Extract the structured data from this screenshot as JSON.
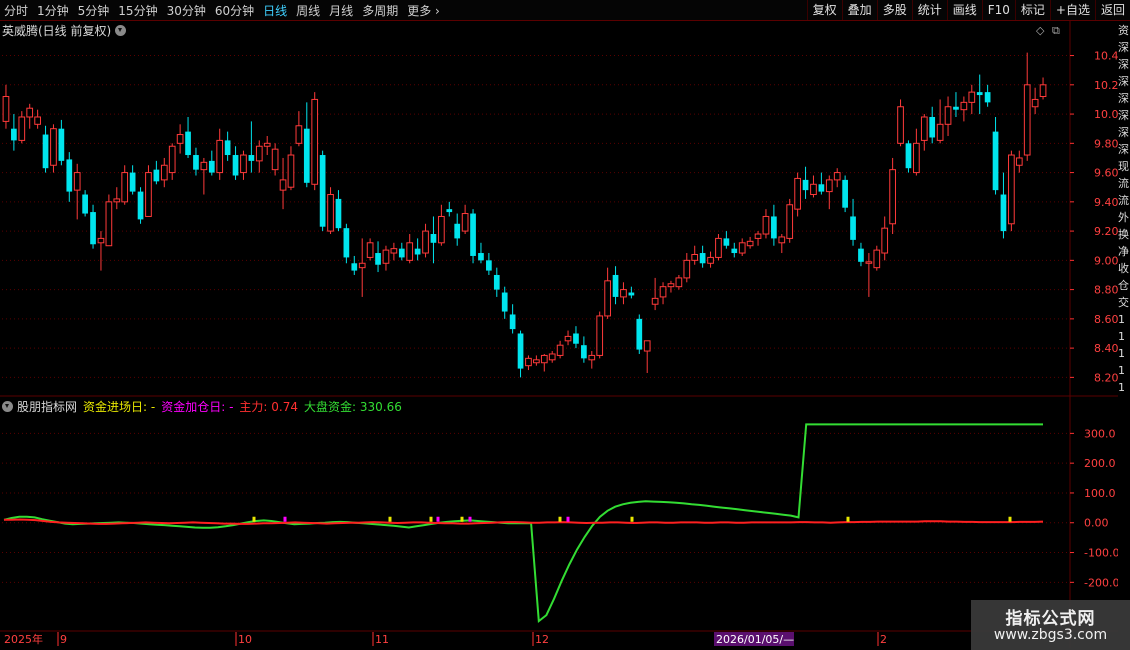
{
  "toolbar": {
    "periods": [
      "分时",
      "1分钟",
      "5分钟",
      "15分钟",
      "30分钟",
      "60分钟",
      "日线",
      "周线",
      "月线",
      "多周期",
      "更多"
    ],
    "active_period": "日线",
    "actions": [
      "复权",
      "叠加",
      "多股",
      "统计",
      "画线",
      "F10",
      "标记",
      "+自选",
      "返回"
    ]
  },
  "main_chart": {
    "title": "英威腾(日线 前复权)",
    "price_axis": [
      "10.40",
      "10.20",
      "10.00",
      "9.80",
      "9.60",
      "9.40",
      "9.20",
      "9.00",
      "8.80",
      "8.60",
      "8.40",
      "8.20"
    ],
    "y_range": [
      8.1,
      10.52
    ]
  },
  "indicator": {
    "name": "股朋指标网",
    "labels": [
      {
        "text": "资金进场日: -",
        "color": "#e8e800"
      },
      {
        "text": "资金加仓日: -",
        "color": "#ff00ff"
      },
      {
        "text": "主力: 0.74",
        "color": "#ff3030"
      },
      {
        "text": "大盘资金: 330.66",
        "color": "#33dd33"
      }
    ],
    "axis": [
      "300.0",
      "200.0",
      "100.0",
      "0.00",
      "-100.0",
      "-200.0"
    ],
    "y_range": [
      -360,
      365
    ]
  },
  "time_axis": {
    "labels": [
      "2025年",
      "9",
      "10",
      "11",
      "12",
      "1",
      "2"
    ],
    "highlight": "2026/01/05/—"
  },
  "right_strip": [
    "资",
    "深",
    "深",
    "深",
    "深",
    "深",
    "深",
    "深",
    "现",
    "流",
    "流",
    "外",
    "换",
    "净",
    "收",
    "仓",
    "交",
    "1",
    "1",
    "1",
    "1",
    "1"
  ],
  "watermark": {
    "title": "指标公式网",
    "url": "www.zbgs3.com"
  },
  "colors": {
    "up": "#ff3a3a",
    "down": "#00e5ee",
    "grid": "#5a0000",
    "main_line": "#33dd33",
    "sub_line": "#ff2020"
  },
  "chart_data": {
    "type": "candlestick",
    "candles": [
      [
        9.95,
        10.2,
        9.9,
        10.12
      ],
      [
        9.9,
        10.0,
        9.75,
        9.82
      ],
      [
        9.82,
        10.02,
        9.8,
        9.98
      ],
      [
        9.98,
        10.07,
        9.9,
        10.04
      ],
      [
        9.93,
        10.03,
        9.9,
        9.98
      ],
      [
        9.86,
        9.92,
        9.6,
        9.63
      ],
      [
        9.65,
        9.93,
        9.6,
        9.9
      ],
      [
        9.9,
        9.96,
        9.65,
        9.68
      ],
      [
        9.69,
        9.74,
        9.4,
        9.47
      ],
      [
        9.48,
        9.66,
        9.28,
        9.6
      ],
      [
        9.45,
        9.48,
        9.3,
        9.32
      ],
      [
        9.33,
        9.38,
        9.08,
        9.11
      ],
      [
        9.12,
        9.2,
        8.93,
        9.15
      ],
      [
        9.1,
        9.45,
        9.1,
        9.4
      ],
      [
        9.4,
        9.5,
        9.35,
        9.42
      ],
      [
        9.4,
        9.65,
        9.38,
        9.6
      ],
      [
        9.6,
        9.65,
        9.45,
        9.47
      ],
      [
        9.47,
        9.5,
        9.25,
        9.28
      ],
      [
        9.3,
        9.65,
        9.3,
        9.6
      ],
      [
        9.62,
        9.68,
        9.52,
        9.54
      ],
      [
        9.55,
        9.7,
        9.5,
        9.65
      ],
      [
        9.6,
        9.8,
        9.55,
        9.78
      ],
      [
        9.8,
        9.93,
        9.73,
        9.86
      ],
      [
        9.88,
        9.98,
        9.7,
        9.72
      ],
      [
        9.72,
        9.77,
        9.58,
        9.62
      ],
      [
        9.62,
        9.7,
        9.45,
        9.67
      ],
      [
        9.68,
        9.75,
        9.58,
        9.6
      ],
      [
        9.6,
        9.9,
        9.55,
        9.82
      ],
      [
        9.82,
        9.88,
        9.68,
        9.72
      ],
      [
        9.72,
        9.78,
        9.55,
        9.58
      ],
      [
        9.6,
        9.75,
        9.55,
        9.72
      ],
      [
        9.72,
        9.95,
        9.6,
        9.68
      ],
      [
        9.68,
        9.82,
        9.6,
        9.78
      ],
      [
        9.78,
        9.85,
        9.72,
        9.8
      ],
      [
        9.62,
        9.8,
        9.58,
        9.76
      ],
      [
        9.48,
        9.7,
        9.35,
        9.55
      ],
      [
        9.5,
        9.78,
        9.48,
        9.72
      ],
      [
        9.8,
        10.02,
        9.78,
        9.92
      ],
      [
        9.9,
        10.08,
        9.5,
        9.53
      ],
      [
        9.52,
        10.15,
        9.48,
        10.1
      ],
      [
        9.72,
        9.75,
        9.2,
        9.23
      ],
      [
        9.2,
        9.5,
        9.18,
        9.45
      ],
      [
        9.42,
        9.48,
        9.2,
        9.22
      ],
      [
        9.22,
        9.25,
        8.98,
        9.02
      ],
      [
        8.98,
        9.03,
        8.9,
        8.93
      ],
      [
        8.95,
        9.15,
        8.75,
        8.98
      ],
      [
        9.02,
        9.15,
        9.0,
        9.12
      ],
      [
        9.05,
        9.13,
        8.92,
        8.97
      ],
      [
        8.98,
        9.1,
        8.93,
        9.07
      ],
      [
        9.05,
        9.12,
        9.0,
        9.08
      ],
      [
        9.08,
        9.12,
        9.0,
        9.02
      ],
      [
        9.0,
        9.18,
        8.98,
        9.12
      ],
      [
        9.08,
        9.15,
        9.0,
        9.04
      ],
      [
        9.05,
        9.25,
        9.02,
        9.2
      ],
      [
        9.18,
        9.3,
        8.98,
        9.12
      ],
      [
        9.12,
        9.38,
        9.1,
        9.3
      ],
      [
        9.35,
        9.4,
        9.3,
        9.33
      ],
      [
        9.25,
        9.32,
        9.1,
        9.15
      ],
      [
        9.2,
        9.38,
        9.18,
        9.32
      ],
      [
        9.32,
        9.35,
        8.98,
        9.03
      ],
      [
        9.05,
        9.12,
        8.98,
        9.0
      ],
      [
        9.0,
        9.05,
        8.9,
        8.93
      ],
      [
        8.9,
        8.95,
        8.75,
        8.8
      ],
      [
        8.78,
        8.82,
        8.6,
        8.65
      ],
      [
        8.63,
        8.7,
        8.5,
        8.53
      ],
      [
        8.5,
        8.52,
        8.2,
        8.26
      ],
      [
        8.28,
        8.35,
        8.25,
        8.33
      ],
      [
        8.3,
        8.35,
        8.28,
        8.32
      ],
      [
        8.3,
        8.36,
        8.24,
        8.35
      ],
      [
        8.32,
        8.38,
        8.3,
        8.36
      ],
      [
        8.35,
        8.45,
        8.33,
        8.42
      ],
      [
        8.45,
        8.52,
        8.42,
        8.48
      ],
      [
        8.5,
        8.55,
        8.4,
        8.43
      ],
      [
        8.42,
        8.48,
        8.3,
        8.33
      ],
      [
        8.32,
        8.38,
        8.26,
        8.35
      ],
      [
        8.35,
        8.65,
        8.33,
        8.62
      ],
      [
        8.62,
        8.95,
        8.6,
        8.86
      ],
      [
        8.9,
        8.96,
        8.7,
        8.75
      ],
      [
        8.75,
        8.85,
        8.7,
        8.8
      ],
      [
        8.78,
        8.82,
        8.74,
        8.76
      ],
      [
        8.6,
        8.63,
        8.36,
        8.39
      ],
      [
        8.38,
        8.4,
        8.23,
        8.45
      ],
      [
        8.7,
        8.88,
        8.66,
        8.74
      ],
      [
        8.75,
        8.85,
        8.7,
        8.82
      ],
      [
        8.82,
        8.86,
        8.78,
        8.84
      ],
      [
        8.82,
        8.9,
        8.8,
        8.88
      ],
      [
        8.88,
        9.05,
        8.85,
        9.0
      ],
      [
        9.0,
        9.1,
        8.97,
        9.04
      ],
      [
        9.05,
        9.1,
        8.95,
        8.98
      ],
      [
        8.98,
        9.06,
        8.95,
        9.02
      ],
      [
        9.02,
        9.18,
        9.0,
        9.15
      ],
      [
        9.15,
        9.2,
        9.08,
        9.1
      ],
      [
        9.08,
        9.12,
        9.02,
        9.05
      ],
      [
        9.05,
        9.15,
        9.03,
        9.12
      ],
      [
        9.1,
        9.16,
        9.08,
        9.13
      ],
      [
        9.15,
        9.2,
        9.1,
        9.18
      ],
      [
        9.18,
        9.35,
        9.15,
        9.3
      ],
      [
        9.3,
        9.38,
        9.1,
        9.15
      ],
      [
        9.12,
        9.18,
        9.05,
        9.16
      ],
      [
        9.15,
        9.42,
        9.12,
        9.38
      ],
      [
        9.35,
        9.6,
        9.3,
        9.56
      ],
      [
        9.55,
        9.64,
        9.42,
        9.48
      ],
      [
        9.45,
        9.58,
        9.43,
        9.52
      ],
      [
        9.52,
        9.6,
        9.45,
        9.47
      ],
      [
        9.47,
        9.58,
        9.35,
        9.55
      ],
      [
        9.55,
        9.63,
        9.5,
        9.6
      ],
      [
        9.55,
        9.58,
        9.33,
        9.36
      ],
      [
        9.3,
        9.42,
        9.1,
        9.14
      ],
      [
        9.08,
        9.12,
        8.96,
        8.99
      ],
      [
        8.98,
        9.05,
        8.75,
        8.99
      ],
      [
        8.95,
        9.1,
        8.93,
        9.07
      ],
      [
        9.05,
        9.3,
        9.0,
        9.22
      ],
      [
        9.25,
        9.7,
        9.18,
        9.62
      ],
      [
        9.8,
        10.1,
        9.78,
        10.05
      ],
      [
        9.8,
        9.82,
        9.6,
        9.63
      ],
      [
        9.6,
        9.9,
        9.58,
        9.8
      ],
      [
        9.82,
        10.0,
        9.75,
        9.98
      ],
      [
        9.98,
        10.05,
        9.8,
        9.84
      ],
      [
        9.82,
        10.1,
        9.8,
        9.93
      ],
      [
        9.93,
        10.12,
        9.85,
        10.05
      ],
      [
        10.05,
        10.15,
        9.98,
        10.03
      ],
      [
        10.03,
        10.12,
        9.95,
        10.08
      ],
      [
        10.08,
        10.2,
        10.0,
        10.15
      ],
      [
        10.15,
        10.27,
        10.0,
        10.13
      ],
      [
        10.15,
        10.2,
        10.05,
        10.08
      ],
      [
        9.88,
        9.98,
        9.45,
        9.48
      ],
      [
        9.45,
        9.6,
        9.15,
        9.2
      ],
      [
        9.25,
        9.75,
        9.2,
        9.72
      ],
      [
        9.65,
        9.75,
        9.6,
        9.7
      ],
      [
        9.72,
        10.42,
        9.68,
        10.2
      ],
      [
        10.05,
        10.18,
        10.0,
        10.1
      ],
      [
        10.12,
        10.25,
        10.1,
        10.2
      ]
    ],
    "indicator_series": {
      "main_force": [
        10,
        10,
        11,
        10,
        9,
        6,
        3,
        1,
        0,
        -1,
        -2,
        -3,
        -4,
        -4,
        -3,
        -2,
        -1,
        0,
        1,
        0,
        -1,
        -2,
        -1,
        0,
        1,
        0,
        -1,
        -2,
        -3,
        -3,
        -4,
        -4,
        -3,
        -2,
        -2,
        -1,
        0,
        1,
        0,
        -1,
        -2,
        -3,
        -2,
        -1,
        0,
        0,
        1,
        2,
        1,
        0,
        -1,
        0,
        1,
        1,
        0,
        -1,
        -2,
        -2,
        -3,
        -3,
        -2,
        -1,
        0,
        1,
        2,
        2,
        1,
        0,
        0,
        1,
        1,
        2,
        1,
        0,
        -1,
        0,
        0,
        1,
        1,
        0,
        -1,
        0,
        1,
        1,
        0,
        0,
        1,
        1,
        1,
        0,
        0,
        1,
        1,
        0,
        0,
        1,
        1,
        1,
        1,
        1,
        1,
        2,
        2,
        1,
        1,
        0,
        1,
        2,
        2,
        3,
        3,
        4,
        4,
        4,
        4,
        4,
        4,
        5,
        5,
        5,
        4,
        4,
        3,
        3,
        2,
        2,
        2,
        2,
        2,
        3,
        3,
        3,
        4
      ],
      "market_funds": [
        10,
        16,
        20,
        20,
        18,
        12,
        7,
        2,
        -3,
        -5,
        -4,
        -3,
        -2,
        -1,
        0,
        1,
        0,
        -1,
        -3,
        -5,
        -7,
        -8,
        -10,
        -12,
        -14,
        -16,
        -17,
        -17,
        -15,
        -12,
        -8,
        -3,
        2,
        6,
        8,
        6,
        2,
        -2,
        -5,
        -4,
        -3,
        -1,
        0,
        2,
        3,
        2,
        0,
        -2,
        -4,
        -6,
        -8,
        -10,
        -13,
        -16,
        -12,
        -8,
        -4,
        0,
        3,
        5,
        7,
        8,
        6,
        4,
        2,
        0,
        -2,
        -2,
        -2,
        -2,
        -330,
        -310,
        -255,
        -195,
        -140,
        -90,
        -48,
        -10,
        20,
        40,
        54,
        62,
        67,
        70,
        72,
        71,
        70,
        69,
        67,
        65,
        62,
        60,
        57,
        54,
        51,
        48,
        45,
        42,
        39,
        36,
        33,
        30,
        27,
        24,
        21,
        18,
        330,
        330,
        330,
        330,
        330,
        330,
        330,
        330,
        330,
        330,
        330,
        330,
        330,
        330,
        330,
        330,
        330,
        330,
        330,
        330,
        330,
        330,
        330,
        330,
        330,
        330,
        330,
        330,
        330,
        330,
        330
      ]
    }
  }
}
